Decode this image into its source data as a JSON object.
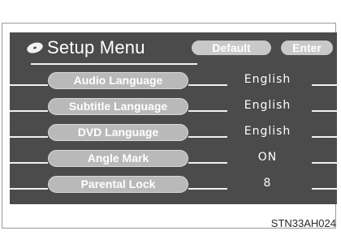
{
  "menu": {
    "title": "Setup Menu",
    "logo_icon": "disc-icon",
    "buttons": {
      "default_label": "Default",
      "enter_label": "Enter"
    },
    "items": [
      {
        "label": "Audio Language",
        "value": "English"
      },
      {
        "label": "Subtitle Language",
        "value": "English"
      },
      {
        "label": "DVD Language",
        "value": "English"
      },
      {
        "label": "Angle Mark",
        "value": "ON"
      },
      {
        "label": "Parental Lock",
        "value": "8"
      }
    ]
  },
  "caption": "STN33AH024",
  "colors": {
    "screen_bg": "#4b4b4b",
    "pill_bg": "#b9b9b9",
    "text": "#ffffff"
  }
}
